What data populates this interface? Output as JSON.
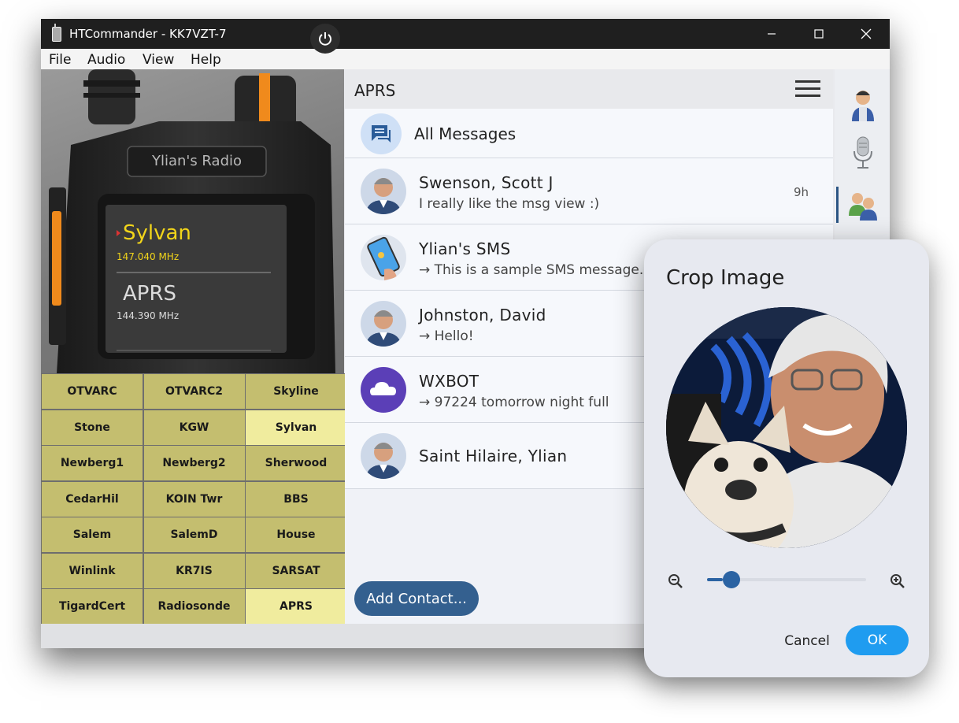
{
  "window": {
    "title": "HTCommander - KK7VZT-7",
    "controls": [
      "minimize-icon",
      "maximize-icon",
      "close-icon"
    ]
  },
  "menu": [
    "File",
    "Audio",
    "View",
    "Help"
  ],
  "radio": {
    "brand_label": "Ylian's Radio",
    "vfo_a": {
      "name": "Sylvan",
      "freq": "147.040 MHz"
    },
    "vfo_b": {
      "name": "APRS",
      "freq": "144.390 MHz"
    },
    "accent_color": "#f08a1c",
    "display_text_color": "#f2d51a"
  },
  "channels": [
    {
      "label": "OTVARC",
      "selected": false
    },
    {
      "label": "OTVARC2",
      "selected": false
    },
    {
      "label": "Skyline",
      "selected": false
    },
    {
      "label": "Stone",
      "selected": false
    },
    {
      "label": "KGW",
      "selected": false
    },
    {
      "label": "Sylvan",
      "selected": true
    },
    {
      "label": "Newberg1",
      "selected": false
    },
    {
      "label": "Newberg2",
      "selected": false
    },
    {
      "label": "Sherwood",
      "selected": false
    },
    {
      "label": "CedarHil",
      "selected": false
    },
    {
      "label": "KOIN Twr",
      "selected": false
    },
    {
      "label": "BBS",
      "selected": false
    },
    {
      "label": "Salem",
      "selected": false
    },
    {
      "label": "SalemD",
      "selected": false
    },
    {
      "label": "House",
      "selected": false
    },
    {
      "label": "Winlink",
      "selected": false
    },
    {
      "label": "KR7IS",
      "selected": false
    },
    {
      "label": "SARSAT",
      "selected": false
    },
    {
      "label": "TigardCert",
      "selected": false
    },
    {
      "label": "Radiosonde",
      "selected": false
    },
    {
      "label": "APRS",
      "selected": true
    }
  ],
  "aprs": {
    "title": "APRS",
    "all_messages": "All Messages",
    "contacts": [
      {
        "name": "Swenson, Scott J",
        "message": "I really like the msg view :)",
        "time": "9h",
        "avatar": "person-avatar"
      },
      {
        "name": "Ylian's SMS",
        "message": "→ This is a sample SMS message.",
        "time": "",
        "avatar": "phone-sms-avatar"
      },
      {
        "name": "Johnston, David",
        "message": "→ Hello!",
        "time": "",
        "avatar": "person-avatar"
      },
      {
        "name": "WXBOT",
        "message": "→ 97224 tomorrow night full",
        "time": "",
        "avatar": "cloud-avatar"
      },
      {
        "name": "Saint Hilaire, Ylian",
        "message": "",
        "time": "",
        "avatar": "person-avatar"
      }
    ],
    "add_contact": "Add Contact..."
  },
  "sidebar": [
    "contact-person-icon",
    "microphone-icon",
    "contacts-group-icon"
  ],
  "crop_dialog": {
    "title": "Crop Image",
    "zoom_level": 0.1,
    "cancel": "Cancel",
    "ok": "OK",
    "accent_color": "#1f9cf0"
  }
}
